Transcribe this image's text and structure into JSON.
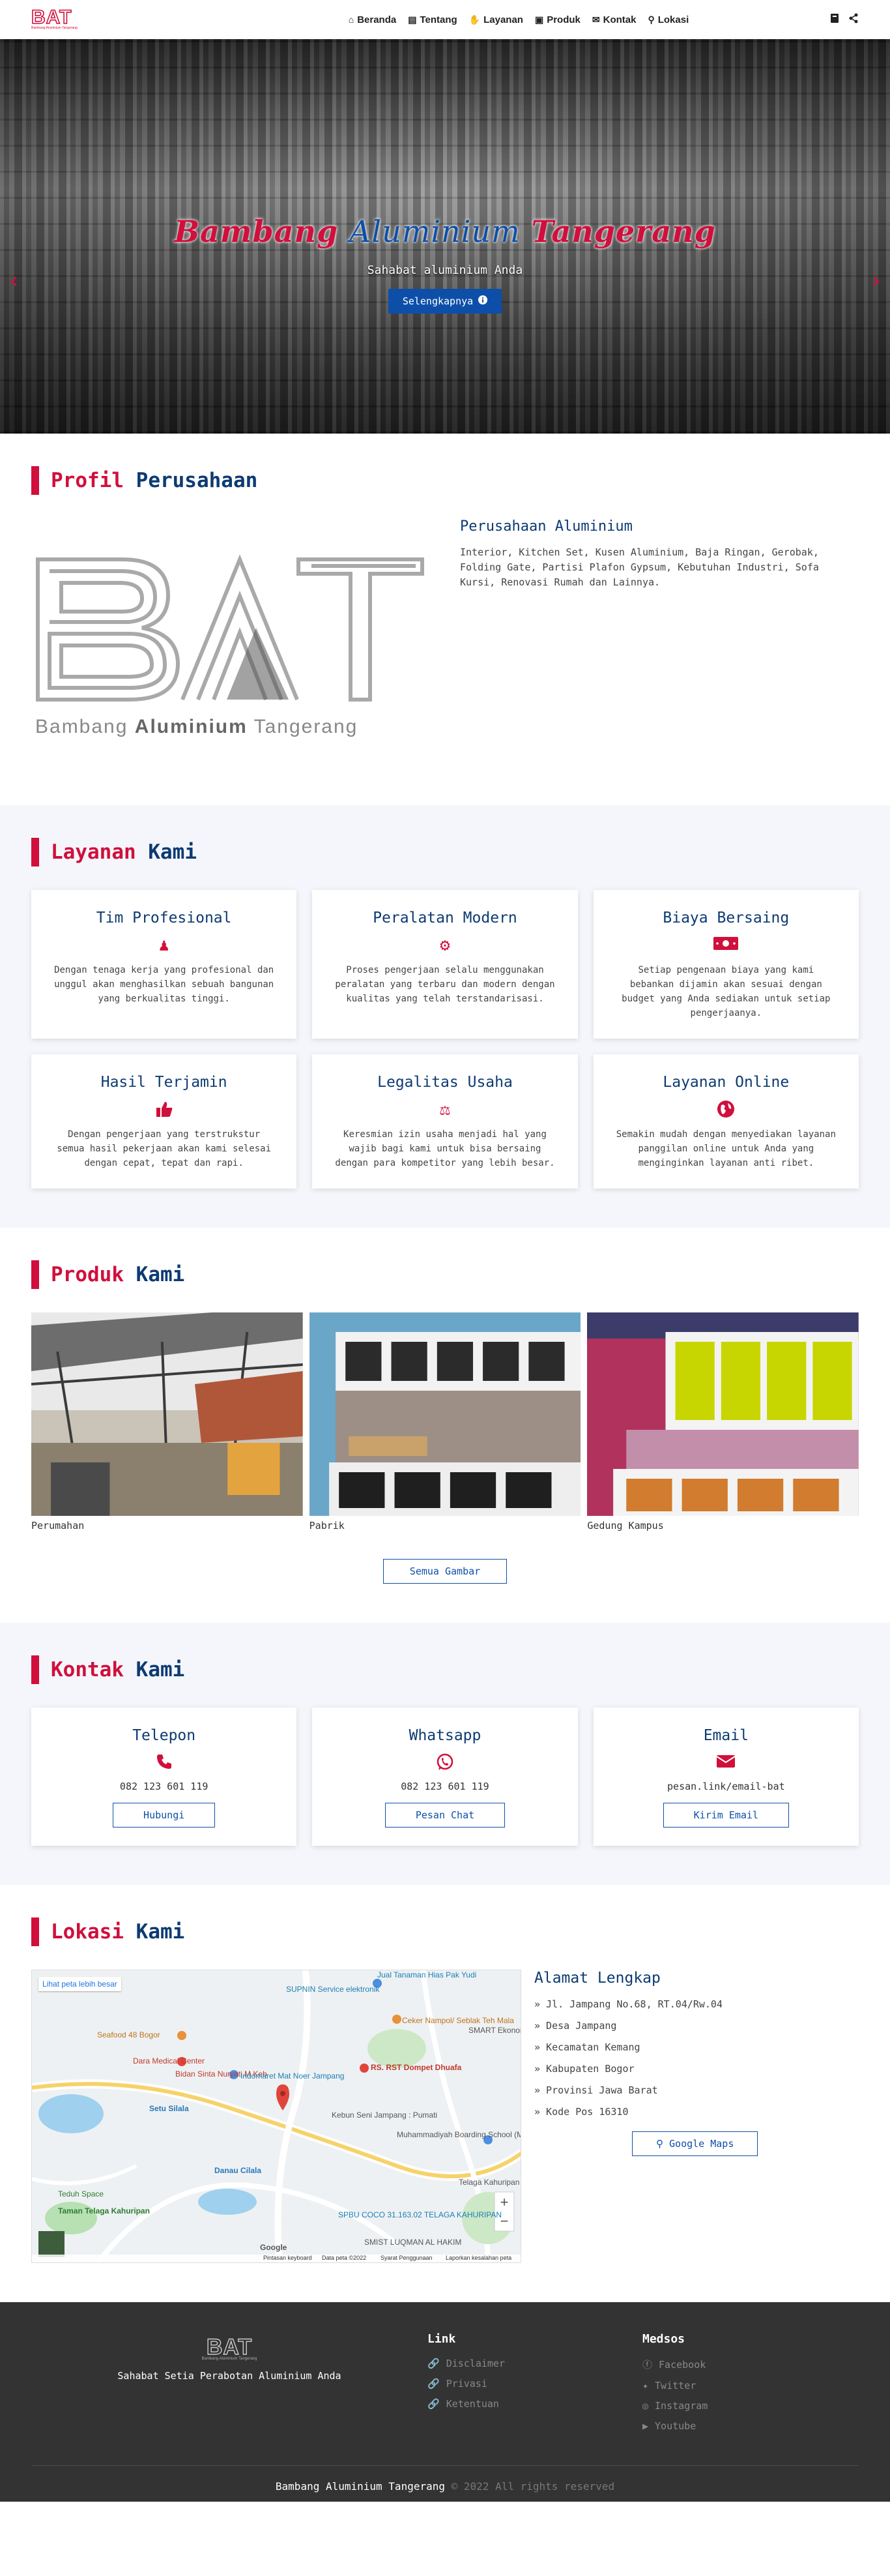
{
  "nav": {
    "logo_text": "BAT",
    "logo_sub": "Bambang Aluminium Tangerang",
    "items": [
      {
        "icon": "home-icon",
        "glyph": "⌂",
        "label": "Beranda"
      },
      {
        "icon": "building-icon",
        "glyph": "▤",
        "label": "Tentang"
      },
      {
        "icon": "handshake-icon",
        "glyph": "✋",
        "label": "Layanan"
      },
      {
        "icon": "box-icon",
        "glyph": "▣",
        "label": "Produk"
      },
      {
        "icon": "chat-icon",
        "glyph": "✉",
        "label": "Kontak"
      },
      {
        "icon": "map-pin-icon",
        "glyph": "⚲",
        "label": "Lokasi"
      }
    ]
  },
  "hero": {
    "title_1": "Bambang",
    "title_2": "Aluminium",
    "title_3": "Tangerang",
    "subtitle": "Sahabat aluminium Anda",
    "button": "Selengkapnya",
    "prev": "‹",
    "next": "›"
  },
  "profile": {
    "title_1": "Profil",
    "title_2": "Perusahaan",
    "logo_caption_1": "Bambang",
    "logo_caption_2": "Aluminium",
    "logo_caption_3": "Tangerang",
    "heading": "Perusahaan Aluminium",
    "text": "Interior, Kitchen Set, Kusen Aluminium, Baja Ringan, Gerobak, Folding Gate, Partisi Plafon Gypsum, Kebutuhan Industri, Sofa Kursi, Renovasi Rumah dan Lainnya."
  },
  "services": {
    "title_1": "Layanan",
    "title_2": "Kami",
    "items": [
      {
        "title": "Tim Profesional",
        "icon": "user-tie-icon",
        "glyph": "♟",
        "text": "Dengan tenaga kerja yang profesional dan unggul akan menghasilkan sebuah bangunan yang berkualitas tinggi."
      },
      {
        "title": "Peralatan Modern",
        "icon": "gears-icon",
        "glyph": "⚙",
        "text": "Proses pengerjaan selalu menggunakan peralatan yang terbaru dan modern dengan kualitas yang telah terstandarisasi."
      },
      {
        "title": "Biaya Bersaing",
        "icon": "money-icon",
        "glyph": "▭",
        "text": "Setiap pengenaan biaya yang kami bebankan dijamin akan sesuai dengan budget yang Anda sediakan untuk setiap pengerjaanya."
      },
      {
        "title": "Hasil Terjamin",
        "icon": "thumbs-up-icon",
        "glyph": "👍",
        "text": "Dengan pengerjaan yang terstrukstur semua hasil pekerjaan akan kami selesai dengan cepat, tepat dan rapi."
      },
      {
        "title": "Legalitas Usaha",
        "icon": "scale-icon",
        "glyph": "⚖",
        "text": "Keresmian izin usaha menjadi hal yang wajib bagi kami untuk bisa bersaing dengan para kompetitor yang lebih besar."
      },
      {
        "title": "Layanan Online",
        "icon": "globe-icon",
        "glyph": "◉",
        "text": "Semakin mudah dengan menyediakan layanan panggilan online untuk Anda yang menginginkan layanan anti ribet."
      }
    ]
  },
  "products": {
    "title_1": "Produk",
    "title_2": "Kami",
    "items": [
      {
        "caption": "Perumahan"
      },
      {
        "caption": "Pabrik"
      },
      {
        "caption": "Gedung Kampus"
      }
    ],
    "button": "Semua Gambar"
  },
  "contact": {
    "title_1": "Kontak",
    "title_2": "Kami",
    "items": [
      {
        "title": "Telepon",
        "icon": "phone-icon",
        "glyph": "✆",
        "value": "082 123 601 119",
        "button": "Hubungi"
      },
      {
        "title": "Whatsapp",
        "icon": "whatsapp-icon",
        "glyph": "✆",
        "value": "082 123 601 119",
        "button": "Pesan Chat"
      },
      {
        "title": "Email",
        "icon": "envelope-icon",
        "glyph": "✉",
        "value": "pesan.link/email-bat",
        "button": "Kirim Email"
      }
    ]
  },
  "location": {
    "title_1": "Lokasi",
    "title_2": "Kami",
    "map_link": "Lihat peta lebih besar",
    "map_labels": [
      "Jual Tanaman Hias Pak Yudi",
      "SUPNIN Service elektronik",
      "Ceker Nampol/ Seblak Teh Mala",
      "SMART Ekonomi",
      "Seafood 48 Bogor",
      "RS. RST Dompet Dhuafa",
      "Dara Medical Center",
      "Bidan Sinta Nuryati,M.Keb",
      "Indomaret Mat Noer Jampang",
      "Setu Silala",
      "Kebun Seni Jampang : Pumati",
      "Muhammadiyah Boarding School (MBS...",
      "Danau Cilala",
      "Telaga Kahuripan",
      "Teduh Space",
      "Taman Telaga Kahuripan",
      "SPBU COCO 31.163.02 TELAGA KAHURIPAN",
      "SMIST LUQMAN AL HAKIM",
      "Google",
      "Pintasan keyboard",
      "Data peta ©2022",
      "Syarat Penggunaan",
      "Laporkan kesalahan peta"
    ],
    "zoom_in": "+",
    "zoom_out": "−",
    "heading": "Alamat Lengkap",
    "lines": [
      "» Jl. Jampang No.68, RT.04/Rw.04",
      "» Desa Jampang",
      "» Kecamatan Kemang",
      "» Kabupaten Bogor",
      "» Provinsi Jawa Barat",
      "» Kode Pos 16310"
    ],
    "button": "Google Maps"
  },
  "footer": {
    "logo_text": "BAT",
    "logo_sub": "Bambang Aluminium Tangerang",
    "tagline": "Sahabat Setia Perabotan Aluminium Anda",
    "link_title": "Link",
    "links": [
      "Disclaimer",
      "Privasi",
      "Ketentuan"
    ],
    "social_title": "Medsos",
    "socials": [
      {
        "icon": "facebook-icon",
        "glyph": "ⓕ",
        "label": "Facebook"
      },
      {
        "icon": "twitter-icon",
        "glyph": "✦",
        "label": "Twitter"
      },
      {
        "icon": "instagram-icon",
        "glyph": "◎",
        "label": "Instagram"
      },
      {
        "icon": "youtube-icon",
        "glyph": "▶",
        "label": "Youtube"
      }
    ],
    "copyright_brand": "Bambang Aluminium Tangerang",
    "copyright_rest": " © 2022 All rights reserved"
  },
  "colors": {
    "accent": "#d10f3c",
    "brand_blue": "#0d3b72",
    "button_blue": "#0d4fa8",
    "footer_bg": "#333333"
  }
}
